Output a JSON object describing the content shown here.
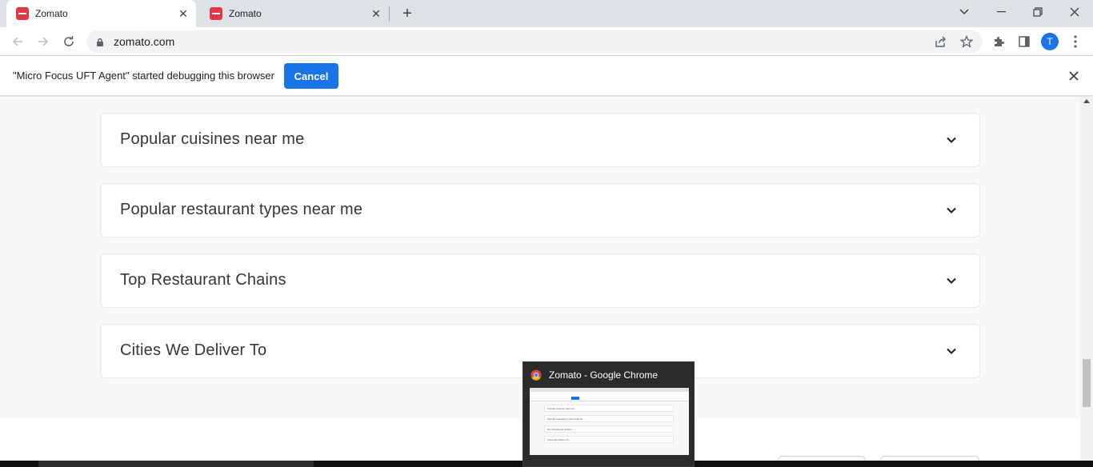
{
  "browser": {
    "tabs": [
      {
        "title": "Zomato",
        "active": true
      },
      {
        "title": "Zomato",
        "active": false
      }
    ],
    "url": "zomato.com",
    "profile_initial": "T"
  },
  "infobar": {
    "message": "\"Micro Focus UFT Agent\" started debugging this browser",
    "cancel_label": "Cancel"
  },
  "accordions": [
    {
      "title": "Popular cuisines near me"
    },
    {
      "title": "Popular restaurant types near me"
    },
    {
      "title": "Top Restaurant Chains"
    },
    {
      "title": "Cities We Deliver To"
    }
  ],
  "taskbar_preview": {
    "title": "Zomato - Google Chrome"
  },
  "colors": {
    "brand": "#e23744",
    "accent": "#1a73e8",
    "page_bg": "#f8f8f8"
  }
}
